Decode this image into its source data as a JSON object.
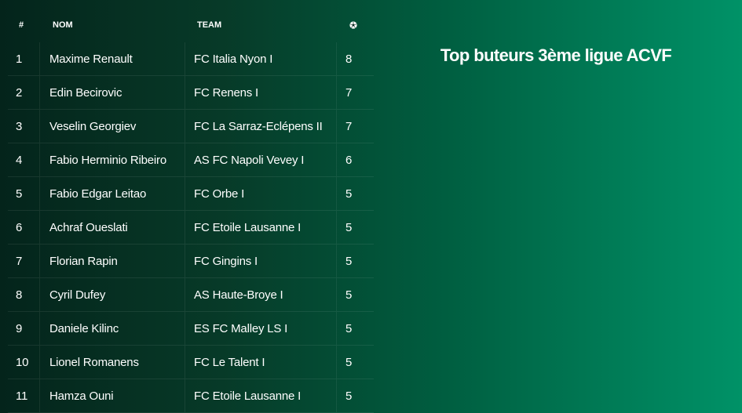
{
  "title": "Top buteurs 3ème ligue ACVF",
  "headers": {
    "rank": "#",
    "name": "NOM",
    "team": "TEAM",
    "goals_icon": "football-icon"
  },
  "rows": [
    {
      "rank": "1",
      "name": "Maxime Renault",
      "team": "FC Italia Nyon I",
      "goals": "8"
    },
    {
      "rank": "2",
      "name": "Edin Becirovic",
      "team": "FC Renens I",
      "goals": "7"
    },
    {
      "rank": "3",
      "name": "Veselin Georgiev",
      "team": "FC La Sarraz-Eclépens II",
      "goals": "7"
    },
    {
      "rank": "4",
      "name": "Fabio Herminio Ribeiro",
      "team": "AS FC Napoli Vevey I",
      "goals": "6"
    },
    {
      "rank": "5",
      "name": "Fabio Edgar Leitao",
      "team": "FC Orbe I",
      "goals": "5"
    },
    {
      "rank": "6",
      "name": "Achraf Oueslati",
      "team": "FC Etoile Lausanne I",
      "goals": "5"
    },
    {
      "rank": "7",
      "name": "Florian Rapin",
      "team": "FC Gingins I",
      "goals": "5"
    },
    {
      "rank": "8",
      "name": "Cyril Dufey",
      "team": "AS Haute-Broye I",
      "goals": "5"
    },
    {
      "rank": "9",
      "name": "Daniele Kilinc",
      "team": "ES FC Malley LS I",
      "goals": "5"
    },
    {
      "rank": "10",
      "name": "Lionel Romanens",
      "team": "FC Le Talent I",
      "goals": "5"
    },
    {
      "rank": "11",
      "name": "Hamza Ouni",
      "team": "FC Etoile Lausanne I",
      "goals": "5"
    }
  ],
  "colors": {
    "background_start": "#04241b",
    "background_end": "#009267",
    "text": "#ffffff"
  }
}
